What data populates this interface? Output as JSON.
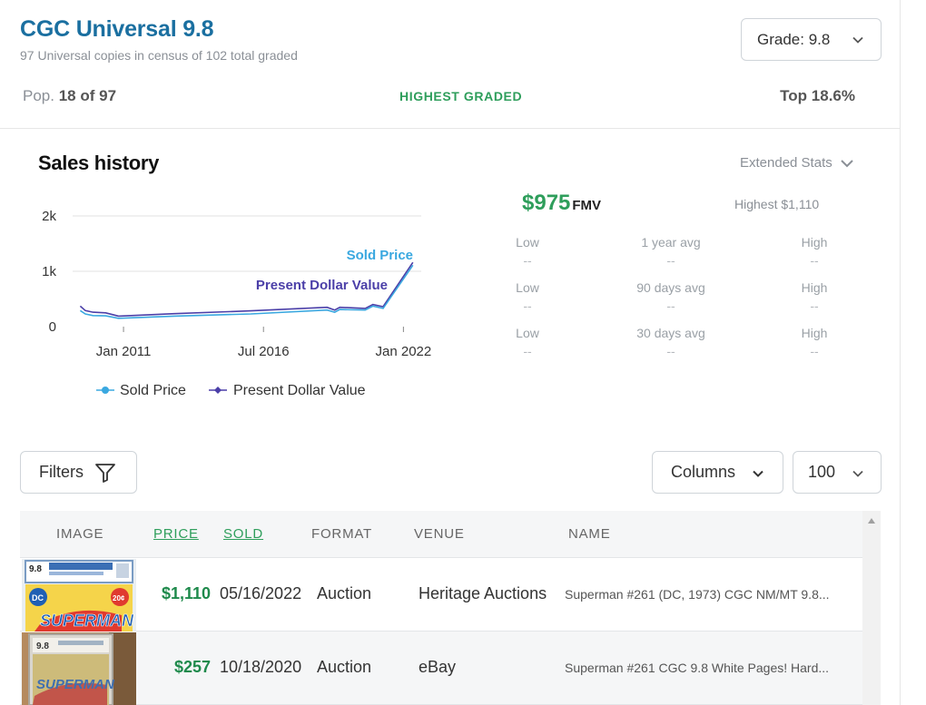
{
  "header": {
    "title": "CGC Universal 9.8",
    "subtitle": "97 Universal copies in census of 102 total graded",
    "grade_select": "Grade: 9.8",
    "pop_label": "Pop.",
    "pop_value": "18 of 97",
    "highest_graded": "HIGHEST GRADED",
    "top_pct": "Top 18.6%"
  },
  "sales": {
    "title": "Sales history",
    "extended_stats": "Extended Stats",
    "fmv_value": "$975",
    "fmv_label": "FMV",
    "highest": "Highest $1,110",
    "stats": [
      {
        "low": "Low",
        "avg": "1 year avg",
        "high": "High",
        "low_v": "--",
        "avg_v": "--",
        "high_v": "--"
      },
      {
        "low": "Low",
        "avg": "90 days avg",
        "high": "High",
        "low_v": "--",
        "avg_v": "--",
        "high_v": "--"
      },
      {
        "low": "Low",
        "avg": "30 days avg",
        "high": "High",
        "low_v": "--",
        "avg_v": "--",
        "high_v": "--"
      }
    ]
  },
  "chart_data": {
    "type": "line",
    "title": "",
    "xlabel": "",
    "ylabel": "",
    "y_ticks": [
      "0",
      "1k",
      "2k"
    ],
    "x_ticks": [
      "Jan 2011",
      "Jul 2016",
      "Jan 2022"
    ],
    "ylim": [
      0,
      2000
    ],
    "xlim": [
      2009.0,
      2022.7
    ],
    "grid": true,
    "legend_position": "bottom",
    "annotations": [
      "Sold Price",
      "Present Dollar Value"
    ],
    "series": [
      {
        "name": "Sold Price",
        "color": "#3aa8e0",
        "x": [
          2009.3,
          2009.5,
          2009.8,
          2010.3,
          2010.8,
          2013.0,
          2016.0,
          2019.0,
          2019.3,
          2019.5,
          2020.5,
          2020.8,
          2021.2,
          2022.37
        ],
        "y": [
          290,
          230,
          200,
          195,
          150,
          190,
          230,
          300,
          260,
          310,
          300,
          370,
          330,
          1110
        ]
      },
      {
        "name": "Present Dollar Value",
        "color": "#4b3fa8",
        "x": [
          2009.3,
          2009.5,
          2009.8,
          2010.3,
          2010.8,
          2013.0,
          2016.0,
          2019.0,
          2019.3,
          2019.5,
          2020.5,
          2020.8,
          2021.2,
          2022.37
        ],
        "y": [
          370,
          290,
          260,
          250,
          190,
          235,
          285,
          350,
          300,
          350,
          330,
          400,
          360,
          1160
        ]
      }
    ]
  },
  "toolbar": {
    "filters": "Filters",
    "columns": "Columns",
    "rows": "100"
  },
  "table": {
    "headers": [
      "IMAGE",
      "PRICE",
      "SOLD",
      "FORMAT",
      "VENUE",
      "NAME"
    ],
    "rows": [
      {
        "price": "$1,110",
        "sold": "05/16/2022",
        "format": "Auction",
        "venue": "Heritage Auctions",
        "name": "Superman #261 (DC, 1973) CGC NM/MT 9.8..."
      },
      {
        "price": "$257",
        "sold": "10/18/2020",
        "format": "Auction",
        "venue": "eBay",
        "name": "Superman #261 CGC 9.8 White Pages! Hard..."
      }
    ],
    "thumb_grade_1": "9.8",
    "thumb_grade_2": "9.8",
    "thumb_price_tag": "20¢",
    "thumb_publisher": "DC",
    "thumb_logo": "SUPERMAN"
  },
  "colors": {
    "title_blue": "#1a6fa0",
    "green": "#2e9e5b",
    "sold_price": "#3aa8e0",
    "present_value": "#4b3fa8"
  }
}
